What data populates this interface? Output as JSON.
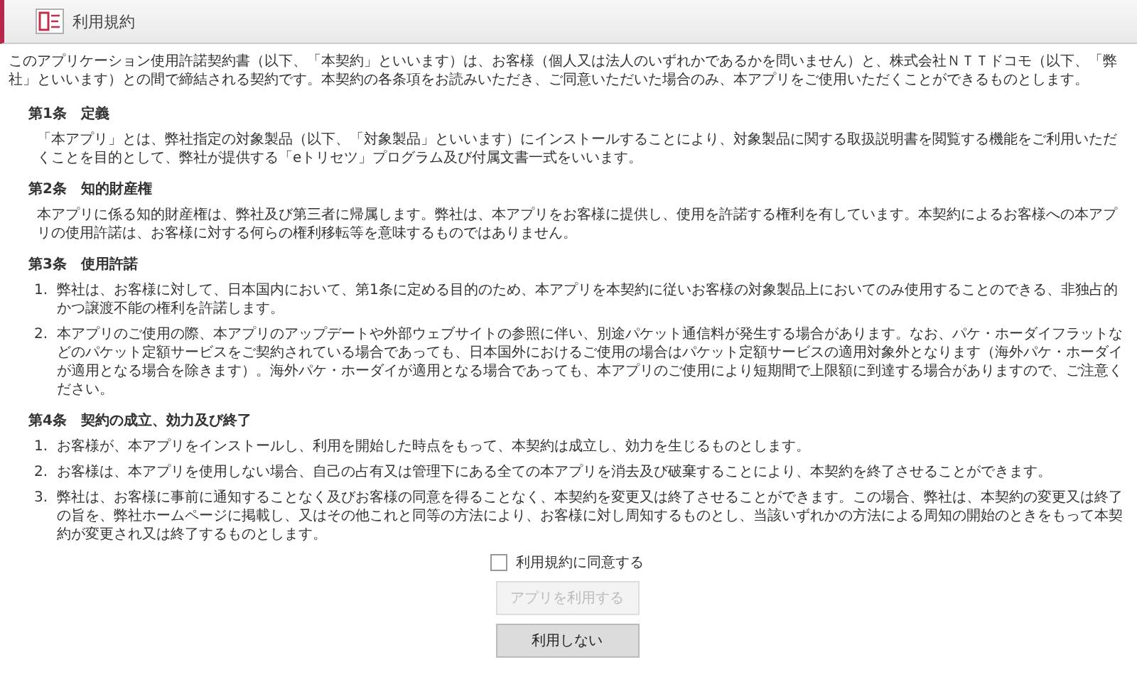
{
  "header": {
    "title": "利用規約"
  },
  "intro": "このアプリケーション使用許諾契約書（以下、「本契約」といいます）は、お客様（個人又は法人のいずれかであるかを問いません）と、株式会社ＮＴＴドコモ（以下、「弊社」といいます）との間で締結される契約です。本契約の各条項をお読みいただき、ご同意いただいた場合のみ、本アプリをご使用いただくことができるものとします。",
  "articles": [
    {
      "heading": "第1条　定義",
      "paragraph": "「本アプリ」とは、弊社指定の対象製品（以下、「対象製品」といいます）にインストールすることにより、対象製品に関する取扱説明書を閲覧する機能をご利用いただくことを目的として、弊社が提供する「eトリセツ」プログラム及び付属文書一式をいいます。"
    },
    {
      "heading": "第2条　知的財産権",
      "paragraph": "本アプリに係る知的財産権は、弊社及び第三者に帰属します。弊社は、本アプリをお客様に提供し、使用を許諾する権利を有しています。本契約によるお客様への本アプリの使用許諾は、お客様に対する何らの権利移転等を意味するものではありません。"
    },
    {
      "heading": "第3条　使用許諾",
      "items": [
        {
          "number": "1.",
          "text": "弊社は、お客様に対して、日本国内において、第1条に定める目的のため、本アプリを本契約に従いお客様の対象製品上においてのみ使用することのできる、非独占的かつ譲渡不能の権利を許諾します。"
        },
        {
          "number": "2.",
          "text": "本アプリのご使用の際、本アプリのアップデートや外部ウェブサイトの参照に伴い、別途パケット通信料が発生する場合があります。なお、パケ・ホーダイフラットなどのパケット定額サービスをご契約されている場合であっても、日本国外におけるご使用の場合はパケット定額サービスの適用対象外となります（海外パケ・ホーダイが適用となる場合を除きます）。海外パケ・ホーダイが適用となる場合であっても、本アプリのご使用により短期間で上限額に到達する場合がありますので、ご注意ください。"
        }
      ]
    },
    {
      "heading": "第4条　契約の成立、効力及び終了",
      "items": [
        {
          "number": "1.",
          "text": "お客様が、本アプリをインストールし、利用を開始した時点をもって、本契約は成立し、効力を生じるものとします。"
        },
        {
          "number": "2.",
          "text": "お客様は、本アプリを使用しない場合、自己の占有又は管理下にある全ての本アプリを消去及び破棄することにより、本契約を終了させることができます。"
        },
        {
          "number": "3.",
          "text": "弊社は、お客様に事前に通知することなく及びお客様の同意を得ることなく、本契約を変更又は終了させることができます。この場合、弊社は、本契約の変更又は終了の旨を、弊社ホームページに掲載し、又はその他これと同等の方法により、お客様に対し周知するものとし、当該いずれかの方法による周知の開始のときをもって本契約が変更され又は終了するものとします。"
        }
      ]
    }
  ],
  "agree": {
    "label": "利用規約に同意する",
    "checked": false
  },
  "buttons": [
    {
      "label": "アプリを利用する",
      "disabled": true
    },
    {
      "label": "利用しない",
      "disabled": false
    }
  ]
}
